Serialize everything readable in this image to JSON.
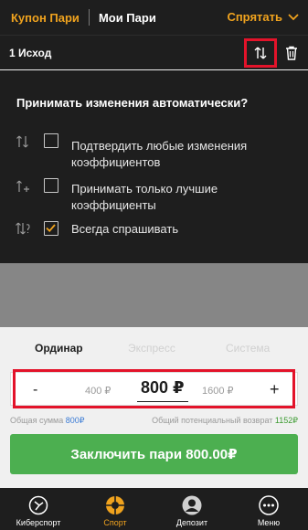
{
  "header": {
    "coupon_tab": "Купон Пари",
    "my_bets_tab": "Мои Пари",
    "hide_label": "Спрятать"
  },
  "outcomes": {
    "count_label": "1 Исход",
    "sort_icon": "swap-arrows-icon",
    "trash_icon": "trash-icon"
  },
  "odds_change": {
    "title": "Принимать изменения автоматически?",
    "options": [
      {
        "icon": "arrows-up-down-icon",
        "label": "Подтвердить любые изменения коэффициентов",
        "checked": false
      },
      {
        "icon": "arrow-up-plus-icon",
        "label": "Принимать только лучшие коэффициенты",
        "checked": false
      },
      {
        "icon": "arrows-question-icon",
        "label": "Всегда спрашивать",
        "checked": true
      }
    ]
  },
  "bet_types": {
    "single": "Ординар",
    "express": "Экспресс",
    "system": "Система",
    "active": "single"
  },
  "stake": {
    "minus": "-",
    "plus": "+",
    "lower_option": "400 ₽",
    "current": "800 ₽",
    "higher_option": "1600 ₽"
  },
  "summary": {
    "total_label": "Общая сумма",
    "total_value": "800₽",
    "return_label": "Общий потенциальный возврат",
    "return_value": "1152₽"
  },
  "place_button": "Заключить пари 800.00₽",
  "nav": [
    {
      "icon": "esports-icon",
      "label": "Киберспорт",
      "active": false
    },
    {
      "icon": "sport-ball-icon",
      "label": "Спорт",
      "active": true
    },
    {
      "icon": "user-icon",
      "label": "Депозит",
      "active": false
    },
    {
      "icon": "more-dots-icon",
      "label": "Меню",
      "active": false
    }
  ],
  "colors": {
    "accent": "#f0a31e",
    "dark_bg": "#1e1e1e",
    "highlight_red": "#e3132a",
    "place_green": "#4caf50",
    "link_blue": "#3a7bd5"
  }
}
